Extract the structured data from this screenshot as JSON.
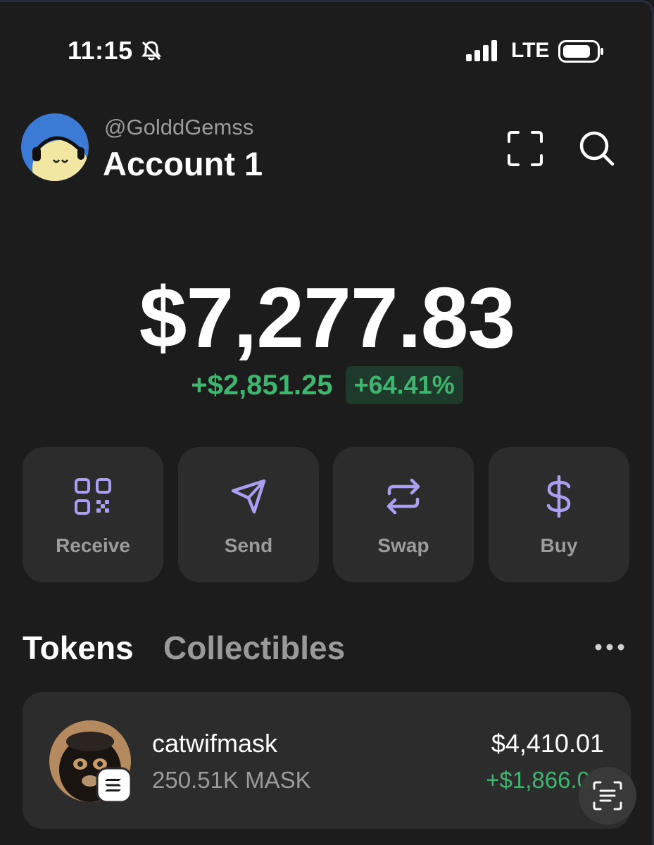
{
  "status_bar": {
    "time": "11:15",
    "network": "LTE"
  },
  "header": {
    "handle": "@GolddGemss",
    "account_name": "Account 1"
  },
  "balance": {
    "total": "$7,277.83",
    "change_usd": "+$2,851.25",
    "change_pct": "+64.41%"
  },
  "actions": [
    {
      "label": "Receive",
      "icon": "qr-code-icon"
    },
    {
      "label": "Send",
      "icon": "send-icon"
    },
    {
      "label": "Swap",
      "icon": "swap-icon"
    },
    {
      "label": "Buy",
      "icon": "dollar-icon"
    }
  ],
  "tabs": {
    "tokens": "Tokens",
    "collectibles": "Collectibles"
  },
  "tokens": [
    {
      "name": "catwifmask",
      "amount": "250.51K MASK",
      "value": "$4,410.01",
      "change": "+$1,866.0"
    }
  ],
  "colors": {
    "accent": "#ab9ff2",
    "positive": "#3fb56f",
    "background": "#1c1c1c",
    "card": "#2c2c2c"
  }
}
